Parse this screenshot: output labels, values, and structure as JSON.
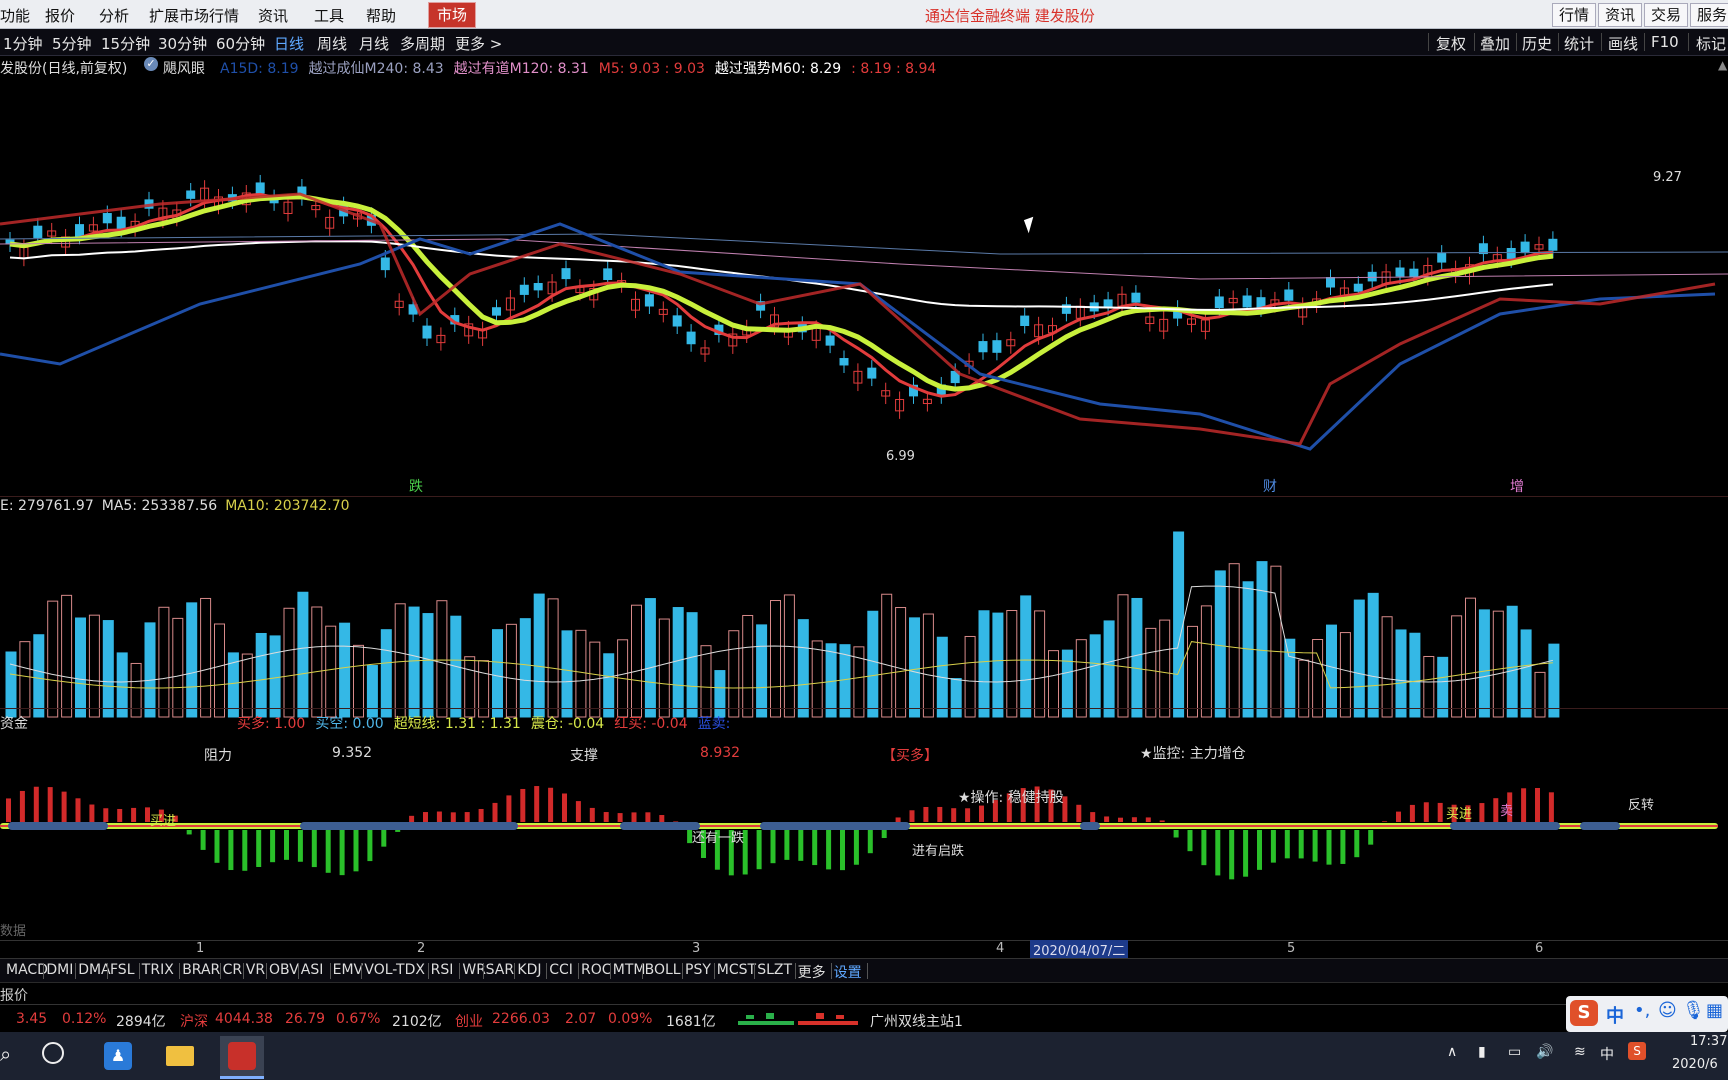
{
  "menubar": {
    "items": [
      "功能",
      "报价",
      "分析",
      "扩展市场行情",
      "资讯",
      "工具",
      "帮助"
    ],
    "market": "市场",
    "title": "通达信金融终端  建发股份",
    "right": [
      "行情",
      "资讯",
      "交易",
      "服务"
    ]
  },
  "periods": {
    "items": [
      "1分钟",
      "5分钟",
      "15分钟",
      "30分钟",
      "60分钟",
      "日线",
      "周线",
      "月线",
      "多周期",
      "更多 >"
    ],
    "active_index": 5,
    "right": [
      "复权",
      "叠加",
      "历史",
      "统计",
      "画线",
      "F10",
      "标记"
    ]
  },
  "main_chart": {
    "name": "发股份(日线,前复权)",
    "indicator": "飓风眼",
    "fields": [
      {
        "text": "A15D: 8.19",
        "color": "#1f4fa8"
      },
      {
        "text": "越过成仙M240: 8.43",
        "color": "#9aa0c0"
      },
      {
        "text": "越过有道M120: 8.31",
        "color": "#e08fc8"
      },
      {
        "text": "M5: 9.03 : 9.03",
        "color": "#e23c3c"
      },
      {
        "text": "越过强势M60: 8.29",
        "color": "#ffffff"
      },
      {
        "text": ": 8.19 : 8.94",
        "color": "#e23c3c"
      }
    ],
    "high_label": "9.27",
    "low_label": "6.99",
    "signals": [
      "跌",
      "财",
      "增"
    ]
  },
  "volume": {
    "fields": [
      {
        "text": "E: 279761.97",
        "color": "#ddd"
      },
      {
        "text": "MA5: 253387.56",
        "color": "#ddd"
      },
      {
        "text": "MA10: 203742.70",
        "color": "#d8d04a"
      }
    ]
  },
  "capital": {
    "name": "资金",
    "fields": [
      {
        "text": "买多: 1.00",
        "color": "#e23c3c"
      },
      {
        "text": "买空: 0.00",
        "color": "#4fb6e8"
      },
      {
        "text": "超短线: 1.31 : 1.31",
        "color": "#d8e84a"
      },
      {
        "text": "震仓: -0.04",
        "color": "#d8e84a"
      },
      {
        "text": "红买: -0.04",
        "color": "#e23c3c"
      },
      {
        "text": "蓝卖:",
        "color": "#2a4fe0"
      }
    ],
    "resistance_label": "阻力",
    "resistance_value": "9.352",
    "support_label": "支撑",
    "support_value": "8.932",
    "buy_tag": "【买多】",
    "monitor": "★监控: 主力增仓",
    "operation": "★操作: 稳健持股",
    "annotations": [
      "买进",
      "还有一跌",
      "进有启跌",
      "买进",
      "卖",
      "反转"
    ]
  },
  "axis": {
    "months": [
      "1",
      "2",
      "3",
      "4",
      "5",
      "6"
    ],
    "cursor_date": "2020/04/07/二",
    "bottom_left": "数据"
  },
  "tabs": [
    "MACD",
    "DMI",
    "DMA",
    "FSL",
    "TRIX",
    "BRAR",
    "CR",
    "VR",
    "OBV",
    "ASI",
    "EMV",
    "VOL-TDX",
    "RSI",
    "WR",
    "SAR",
    "KDJ",
    "CCI",
    "ROC",
    "MTM",
    "BOLL",
    "PSY",
    "MCST",
    "SLZT",
    "更多",
    "设置"
  ],
  "report_label": "报价",
  "quotes": {
    "a1": "3.45",
    "a2": "0.12%",
    "a3": "2894亿",
    "b_name": "沪深",
    "b1": "4044.38",
    "b2": "26.79",
    "b3": "0.67%",
    "b4": "2102亿",
    "c_name": "创业",
    "c1": "2266.03",
    "c2": "2.07",
    "c3": "0.09%",
    "c4": "1681亿",
    "station": "广州双线主站1"
  },
  "taskbar": {
    "time": "17:37",
    "date": "2020/6",
    "ime": "中"
  },
  "colors": {
    "up": "#e23c3c",
    "down": "#34b8e6",
    "ma_yellow": "#c8f03c",
    "ma_blue": "#1f4fa8",
    "ma_white": "#ffffff",
    "ma_pink": "#c080b0"
  }
}
